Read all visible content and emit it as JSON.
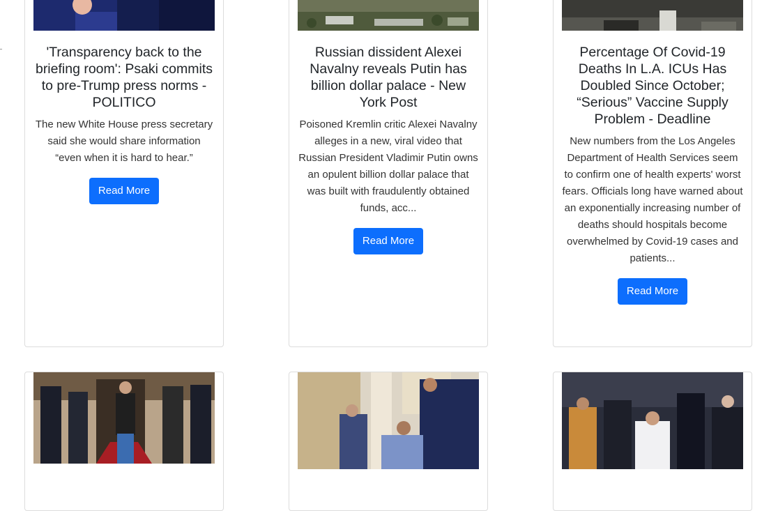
{
  "cards": [
    {
      "title": "'Transparency back to the briefing room': Psaki commits to pre-Trump press norms - POLITICO",
      "description": "The new White House press secretary said she would share information “even when it is hard to hear.”",
      "button": "Read More"
    },
    {
      "title": "Russian dissident Alexei Navalny reveals Putin has billion dollar palace - New York Post",
      "description": "Poisoned Kremlin critic Alexei Navalny alleges in a new, viral video that Russian President Vladimir Putin owns an opulent billion dollar palace that was built with fraudulently obtained funds, acc...",
      "button": "Read More"
    },
    {
      "title": "Percentage Of Covid-19 Deaths In L.A. ICUs Has Doubled Since October; “Serious” Vaccine Supply Problem - Deadline",
      "description": "New numbers from the Los Angeles Department of Health Services seem to confirm one of health experts' worst fears. Officials long have warned about an exponentially increasing number of deaths should hospitals become overwhelmed by Covid-19 cases and patients...",
      "button": "Read More"
    }
  ]
}
